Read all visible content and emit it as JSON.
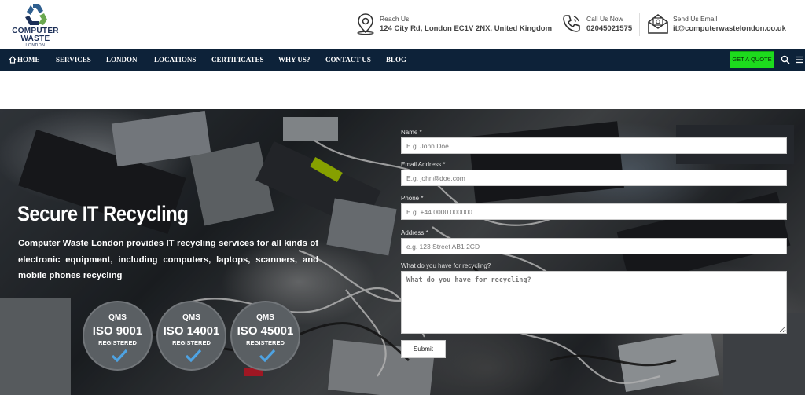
{
  "logo": {
    "line1": "COMPUTER",
    "line2": "WASTE",
    "line3": "LONDON"
  },
  "contacts": [
    {
      "icon": "location-pin-icon",
      "label": "Reach Us",
      "value": "124 City Rd, London EC1V 2NX, United Kingdom"
    },
    {
      "icon": "phone-icon",
      "label": "Call Us Now",
      "value": "02045021575"
    },
    {
      "icon": "email-icon",
      "label": "Send Us Email",
      "value": "it@computerwastelondon.co.uk"
    }
  ],
  "nav": {
    "items": [
      "HOME",
      "SERVICES",
      "LONDON",
      "LOCATIONS",
      "CERTIFICATES",
      "WHY US?",
      "CONTACT US",
      "BLOG"
    ],
    "cta": "GET A QUOTE"
  },
  "hero": {
    "title": "Secure IT Recycling",
    "description": "Computer Waste London provides IT recycling services for all kinds of electronic equipment, including computers, laptops, scanners, and mobile phones recycling"
  },
  "badges": [
    {
      "brand": "QMS",
      "standard": "ISO 9001",
      "status": "REGISTERED"
    },
    {
      "brand": "QMS",
      "standard": "ISO 14001",
      "status": "REGISTERED"
    },
    {
      "brand": "QMS",
      "standard": "ISO 45001",
      "status": "REGISTERED"
    }
  ],
  "form": {
    "name": {
      "label": "Name *",
      "placeholder": "E.g. John Doe"
    },
    "email": {
      "label": "Email Address *",
      "placeholder": "E.g. john@doe.com"
    },
    "phone": {
      "label": "Phone *",
      "placeholder": "E.g. +44 0000 000000"
    },
    "address": {
      "label": "Address *",
      "placeholder": "e.g. 123 Street AB1 2CD"
    },
    "recycling": {
      "label": "What do you have for recycling?",
      "placeholder": "What do you have for recycling?"
    },
    "submit": "Submit"
  },
  "colors": {
    "nav_bg": "#0d2239",
    "cta": "#1ddb1d",
    "brand": "#1c2f57"
  }
}
